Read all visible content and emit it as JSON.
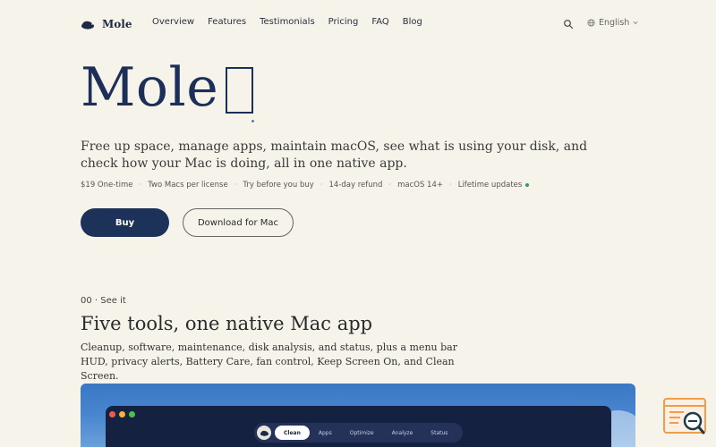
{
  "nav": {
    "brand": "Mole",
    "links": [
      "Overview",
      "Features",
      "Testimonials",
      "Pricing",
      "FAQ",
      "Blog"
    ],
    "language": "English",
    "icons": {
      "search": "search-icon",
      "globe": "globe-icon",
      "chevron": "chevron-down-icon"
    }
  },
  "hero": {
    "title": "Mole",
    "subtitle": "Free up space, manage apps, maintain macOS, see what is using your disk, and check how your Mac is doing, all in one native app.",
    "facts": [
      "$19 One-time",
      "Two Macs per license",
      "Try before you buy",
      "14-day refund",
      "macOS 14+",
      "Lifetime updates"
    ],
    "buy_label": "Buy",
    "download_label": "Download for Mac"
  },
  "section": {
    "kicker": "00 · See it",
    "title": "Five tools, one native Mac app",
    "description": "Cleanup, software, maintenance, disk analysis, and status, plus a menu bar HUD, privacy alerts, Battery Care, fan control, Keep Screen On, and Clean Screen."
  },
  "app_preview": {
    "tabs": [
      "Clean",
      "Apps",
      "Optimize",
      "Analyze",
      "Status"
    ],
    "active_tab": "Clean"
  },
  "colors": {
    "background": "#f6f3ea",
    "primary": "#1d3258",
    "accent_green": "#2e9c5a"
  }
}
